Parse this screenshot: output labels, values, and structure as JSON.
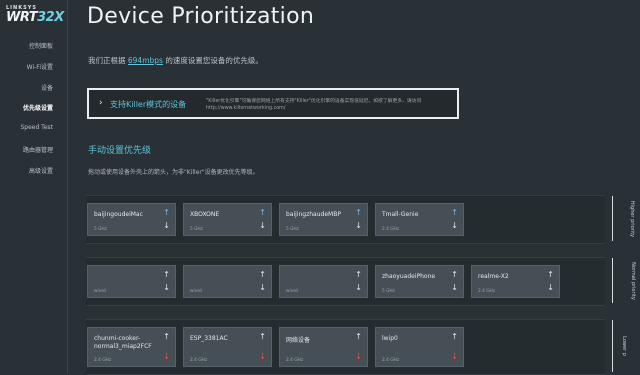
{
  "logo": {
    "brand": "LINKSYS",
    "model_prefix": "WRT",
    "model_num": "32X"
  },
  "sidebar": {
    "items": [
      {
        "label": "控制面板",
        "active": false
      },
      {
        "label": "Wi-Fi设置",
        "active": false
      },
      {
        "label": "设备",
        "active": false
      },
      {
        "label": "优先级设置",
        "active": true
      },
      {
        "label": "Speed Test",
        "active": false
      },
      {
        "label": "路由器管理",
        "active": false
      },
      {
        "label": "高级设置",
        "active": false
      }
    ]
  },
  "header": {
    "title": "Device Prioritization",
    "subtitle_pre": "我们正根据",
    "subtitle_speed": "694mbps",
    "subtitle_post": "的速度设置您设备的优先级。"
  },
  "killer": {
    "title": "支持Killer模式的设备",
    "desc_line1": "\"Killer优化引擎\"可确保您网络上所有支持\"Killer\"优化引擎的设备实现低延迟。如欲了解更多，请访问",
    "desc_line2": "http://www.killernetworking.com/"
  },
  "manual": {
    "title": "手动设置优先级",
    "desc": "拖动或使用设备外壳上的箭头，为非\"Killer\"设备更改优先等级。"
  },
  "colors": {
    "accent": "#5fc4dc",
    "arrow_up_active": "#5fc4dc",
    "arrow_down_low": "#e05a44"
  },
  "rows": [
    {
      "label": "Higher priority",
      "cards": [
        {
          "name": "baijingoudeiMac",
          "name2": "",
          "freq": "5 GHz",
          "up_color": "#5fc4dc",
          "down_color": "#dfe6ea"
        },
        {
          "name": "XBOXONE",
          "name2": "",
          "freq": "5 GHz",
          "up_color": "#5fc4dc",
          "down_color": "#dfe6ea"
        },
        {
          "name": "baijingzhaudeMBP",
          "name2": "",
          "freq": "5 GHz",
          "up_color": "#5fc4dc",
          "down_color": "#dfe6ea"
        },
        {
          "name": "Tmall-Genie",
          "name2": "",
          "freq": "2.4 GHz",
          "up_color": "#5fc4dc",
          "down_color": "#dfe6ea"
        }
      ]
    },
    {
      "label": "Normal priority",
      "cards": [
        {
          "name": "",
          "name2": "",
          "freq": "wired",
          "up_color": "#dfe6ea",
          "down_color": "#dfe6ea"
        },
        {
          "name": "",
          "name2": "",
          "freq": "wired",
          "up_color": "#dfe6ea",
          "down_color": "#dfe6ea"
        },
        {
          "name": "",
          "name2": "",
          "freq": "wired",
          "up_color": "#dfe6ea",
          "down_color": "#dfe6ea"
        },
        {
          "name": "zhaoyuadeiPhone",
          "name2": "",
          "freq": "5 GHz",
          "up_color": "#dfe6ea",
          "down_color": "#dfe6ea"
        },
        {
          "name": "realme-X2",
          "name2": "",
          "freq": "2.4 GHz",
          "up_color": "#dfe6ea",
          "down_color": "#dfe6ea"
        }
      ]
    },
    {
      "label": "Lower p",
      "cards": [
        {
          "name": "chunmi-cooker-",
          "name2": "normal3_miap2FCF",
          "freq": "2.4 GHz",
          "up_color": "#dfe6ea",
          "down_color": "#e05a44"
        },
        {
          "name": "ESP_3381AC",
          "name2": "",
          "freq": "2.4 GHz",
          "up_color": "#dfe6ea",
          "down_color": "#e05a44"
        },
        {
          "name": "网络设备",
          "name2": "",
          "freq": "2.4 GHz",
          "up_color": "#dfe6ea",
          "down_color": "#e05a44"
        },
        {
          "name": "lwip0",
          "name2": "",
          "freq": "2.4 GHz",
          "up_color": "#dfe6ea",
          "down_color": "#e05a44"
        }
      ]
    }
  ],
  "icons": {
    "up": "↑",
    "down": "↓",
    "chevron": "›"
  }
}
